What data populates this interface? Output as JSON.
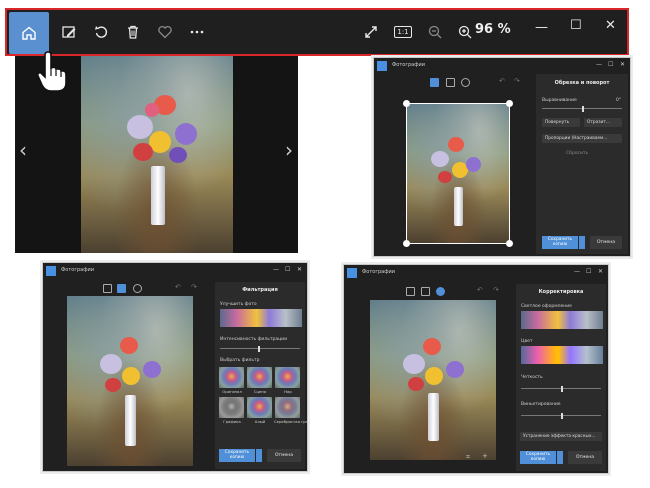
{
  "toolbar": {
    "zoom": "96 %",
    "icons": [
      "home-icon",
      "edit-image-icon",
      "rotate-icon",
      "delete-icon",
      "favorite-heart-icon",
      "more-options-icon",
      "fullscreen-icon",
      "actual-size-icon",
      "zoom-out-icon",
      "zoom-in-icon"
    ],
    "actual_size_glyph": "1:1",
    "accent": "#5a8fd0",
    "highlight_border": "#d9262b"
  },
  "viewer": {
    "prev_glyph": "‹",
    "next_glyph": "›"
  },
  "win_crop": {
    "app": "Фотографии",
    "panel_title": "Обрезка и поворот",
    "straighten_label": "Выравнивание",
    "straighten_value": "0°",
    "rotate_label": "Повернуть",
    "flip_label": "Отразит...",
    "aspect_label": "Пропорции (Настраиваем...",
    "reset_label": "Сбросить",
    "save_label": "Сохранить копию",
    "cancel_label": "Отмена"
  },
  "win_filter": {
    "app": "Фотографии",
    "panel_title": "Фильтрация",
    "enhance_label": "Улучшить фото",
    "intensity_label": "Интенсивность фильтрации",
    "choose_label": "Выбрать фильтр",
    "filters": [
      "Оригинал",
      "Сцена",
      "Нар",
      "Графика",
      "Алый",
      "Серебристая гра..."
    ],
    "save_label": "Сохранить копию",
    "cancel_label": "Отмена"
  },
  "win_adjust": {
    "app": "Фотографии",
    "panel_title": "Корректировка",
    "light_label": "Светлое оформление",
    "color_label": "Цвет",
    "clarity_label": "Четкость",
    "vignette_label": "Виньетирование",
    "redeye_label": "Устранение эффекта красных...",
    "save_label": "Сохранить копию",
    "cancel_label": "Отмена"
  },
  "window_controls": {
    "minimize": "—",
    "maximize": "☐",
    "close": "✕"
  }
}
